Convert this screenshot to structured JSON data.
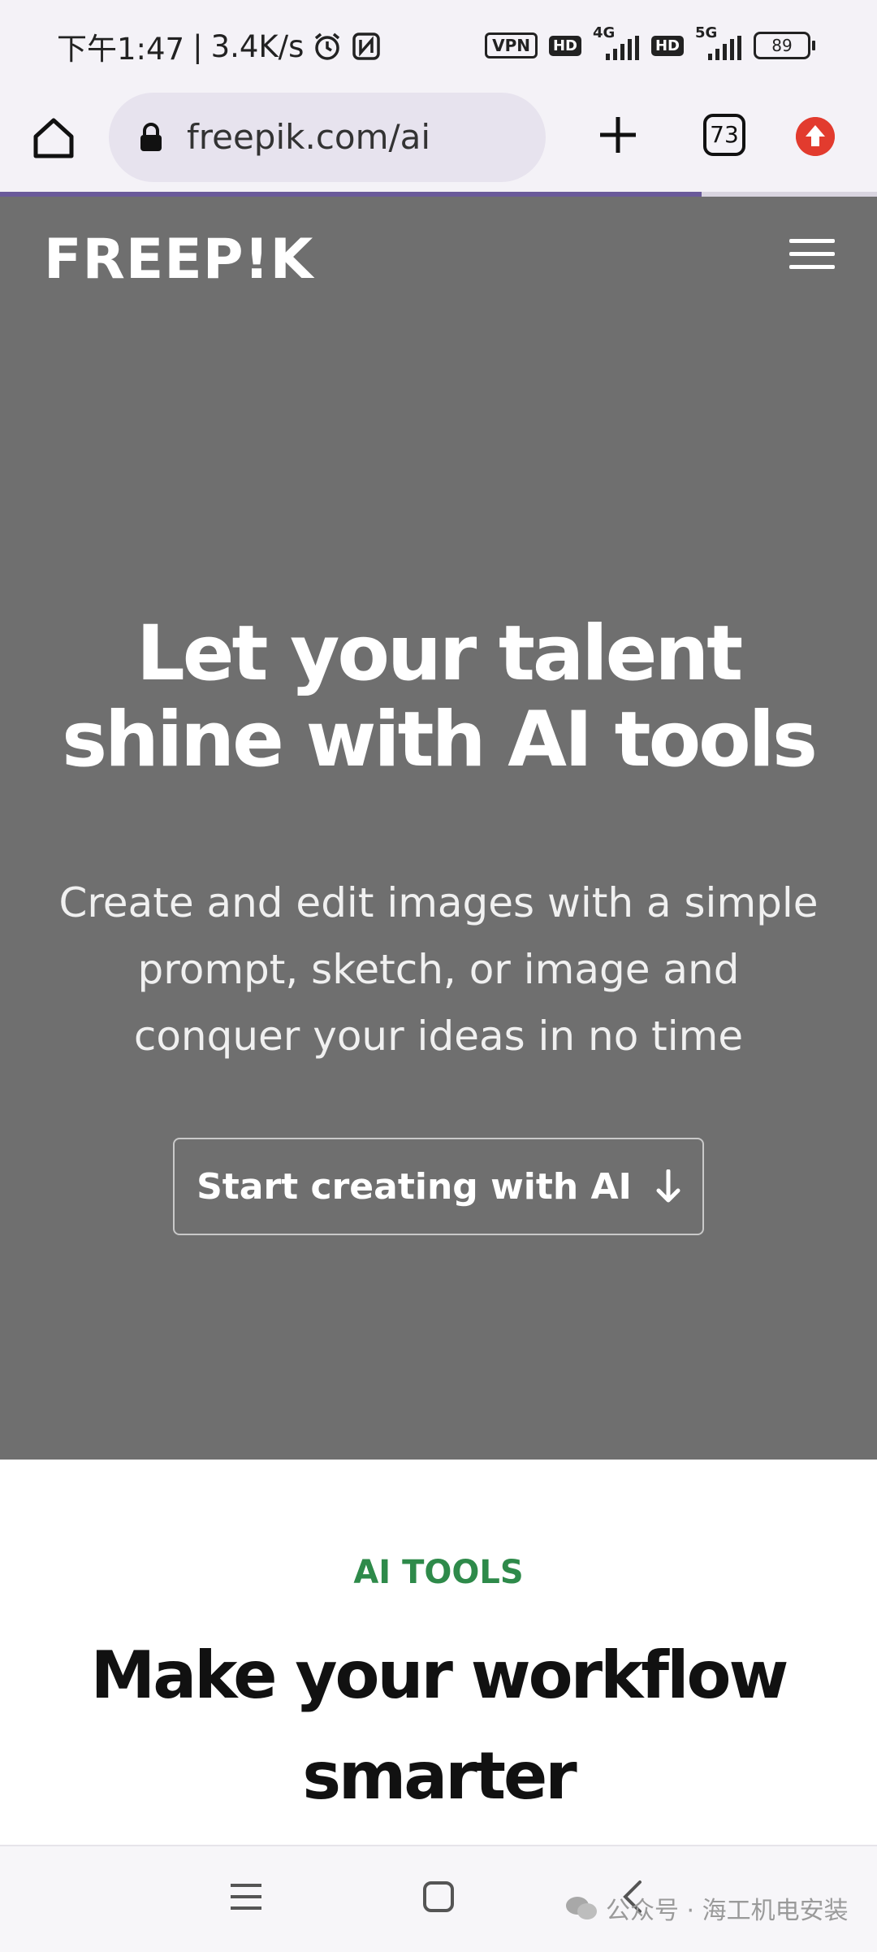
{
  "status_bar": {
    "time": "下午1:47",
    "separator": "|",
    "net_speed": "3.4K/s",
    "vpn_label": "VPN",
    "hd_label": "HD",
    "net1_label": "4G",
    "net2_label": "5G",
    "battery": "89"
  },
  "browser": {
    "url": "freepik.com/ai",
    "tab_count": "73",
    "load_progress": 0.8
  },
  "hero": {
    "logo": "FREEP!K",
    "title_line1": "Let your talent",
    "title_line2": "shine with AI tools",
    "subtitle_line1": "Create and edit images with a simple",
    "subtitle_line2": "prompt, sketch, or image and",
    "subtitle_line3": "conquer your ideas in no time",
    "cta_label": "Start creating with AI",
    "bg_color": "#6f6f6f"
  },
  "section": {
    "eyebrow": "AI TOOLS",
    "title_line1": "Make your workflow",
    "title_line2": "smarter",
    "eyebrow_color": "#2e8a4a"
  },
  "watermark": {
    "text": "公众号 · 海工机电安装"
  },
  "icons": {
    "home": "home-icon",
    "lock": "lock-icon",
    "new_tab": "plus-icon",
    "tabs": "tab-switcher-icon",
    "update": "update-arrow-icon",
    "menu": "hamburger-menu-icon",
    "cta_arrow": "arrow-down-icon"
  }
}
